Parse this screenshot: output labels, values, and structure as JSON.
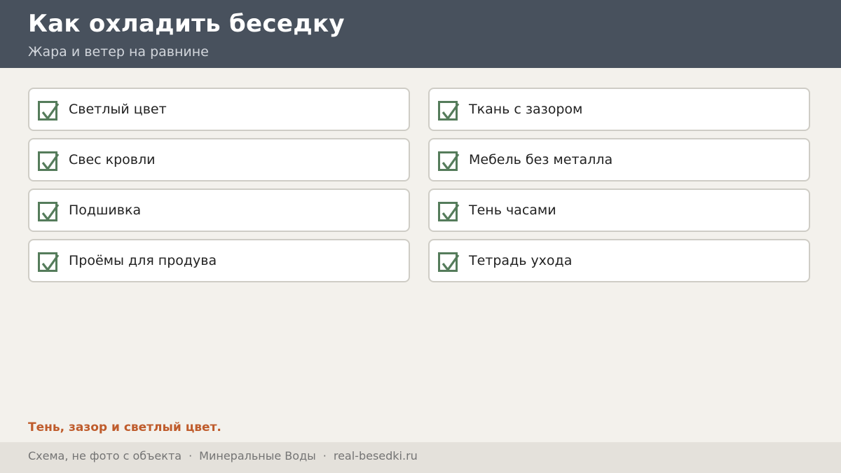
{
  "header": {
    "title": "Как охладить беседку",
    "subtitle": "Жара и ветер на равнине"
  },
  "checklist": {
    "items": [
      {
        "label": "Светлый цвет",
        "checked": true
      },
      {
        "label": "Ткань с зазором",
        "checked": true
      },
      {
        "label": "Свес кровли",
        "checked": true
      },
      {
        "label": "Мебель без металла",
        "checked": true
      },
      {
        "label": "Подшивка",
        "checked": true
      },
      {
        "label": "Тень часами",
        "checked": true
      },
      {
        "label": "Проёмы для продува",
        "checked": true
      },
      {
        "label": "Тетрадь ухода",
        "checked": true
      }
    ]
  },
  "tagline": "Тень, зазор и светлый цвет.",
  "footer": {
    "note": "Схема, не фото с объекта",
    "city": "Минеральные Воды",
    "site": "real-besedki.ru",
    "separator": "·"
  },
  "colors": {
    "header_bg": "#48515d",
    "check": "#557c5b",
    "accent": "#bf5c2c"
  },
  "icons": {
    "checkbox": "checkbox-checked-icon"
  }
}
